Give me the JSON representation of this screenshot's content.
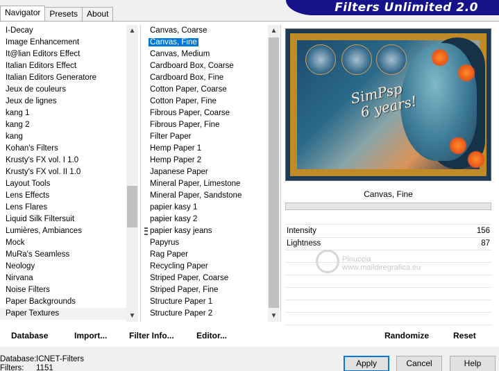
{
  "tabs": [
    "Navigator",
    "Presets",
    "About"
  ],
  "title": "Filters Unlimited 2.0",
  "categories": [
    "I-Decay",
    "Image Enhancement",
    "It@lian Editors Effect",
    "Italian Editors Effect",
    "Italian Editors Generatore",
    "Jeux de couleurs",
    "Jeux de lignes",
    "kang 1",
    "kang 2",
    "kang",
    "Kohan's Filters",
    "Krusty's FX vol. I 1.0",
    "Krusty's FX vol. II 1.0",
    "Layout Tools",
    "Lens Effects",
    "Lens Flares",
    "Liquid Silk Filtersuit",
    "Lumières, Ambiances",
    "Mock",
    "MuRa's Seamless",
    "Neology",
    "Nirvana",
    "Noise Filters",
    "Paper Backgrounds",
    "Paper Textures"
  ],
  "selected_category": "Paper Textures",
  "filters": [
    "Canvas, Coarse",
    "Canvas, Fine",
    "Canvas, Medium",
    "Cardboard Box, Coarse",
    "Cardboard Box, Fine",
    "Cotton Paper, Coarse",
    "Cotton Paper, Fine",
    "Fibrous Paper, Coarse",
    "Fibrous Paper, Fine",
    "Filter Paper",
    "Hemp Paper 1",
    "Hemp Paper 2",
    "Japanese Paper",
    "Mineral Paper, Limestone",
    "Mineral Paper, Sandstone",
    "papier kasy 1",
    "papier kasy 2",
    "papier kasy jeans",
    "Papyrus",
    "Rag Paper",
    "Recycling Paper",
    "Striped Paper, Coarse",
    "Striped Paper, Fine",
    "Structure Paper 1",
    "Structure Paper 2"
  ],
  "selected_filter": "Canvas, Fine",
  "preview": {
    "text_line1": "SimPsp",
    "text_line2": "6 years!"
  },
  "filter_name": "Canvas, Fine",
  "params": [
    {
      "label": "Intensity",
      "value": "156"
    },
    {
      "label": "Lightness",
      "value": "87"
    }
  ],
  "watermark": {
    "line1": "Pinuccia",
    "line2": "www.maildiregrafica.eu"
  },
  "toolbar": {
    "database": "Database",
    "import": "Import...",
    "filter_info": "Filter Info...",
    "editor": "Editor...",
    "randomize": "Randomize",
    "reset": "Reset"
  },
  "status": {
    "database_label": "Database:",
    "database_value": "ICNET-Filters",
    "filters_label": "Filters:",
    "filters_value": "1151"
  },
  "buttons": {
    "apply": "Apply",
    "cancel": "Cancel",
    "help": "Help"
  },
  "colors": {
    "selection": "#0078d7",
    "banner": "#16128a",
    "frame_gold": "#c08a26"
  }
}
